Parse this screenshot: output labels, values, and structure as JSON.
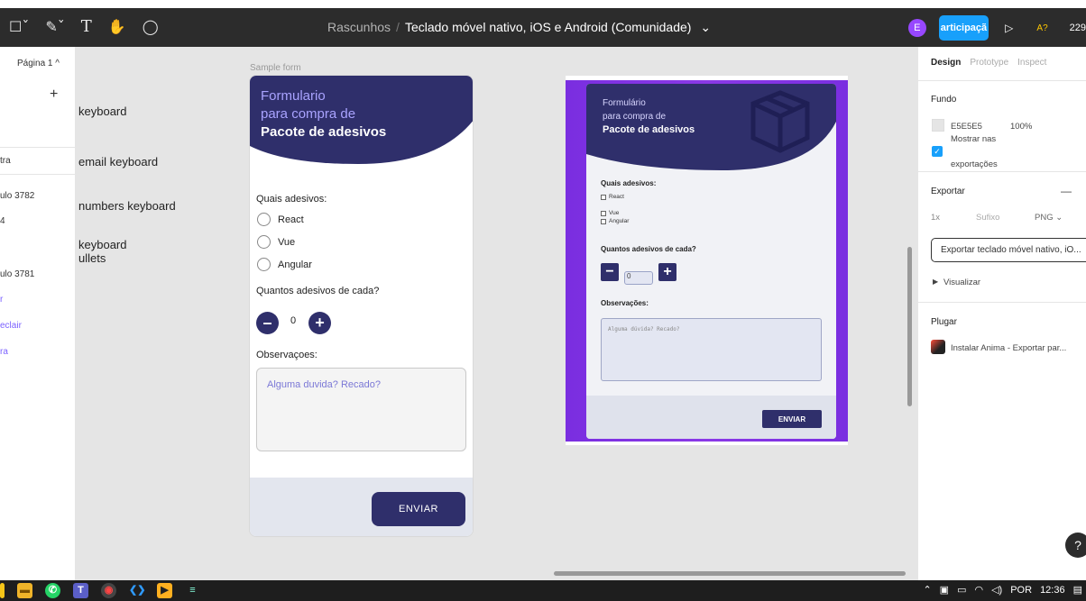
{
  "toolbar": {
    "breadcrumb_parent": "Rascunhos",
    "breadcrumb_sep": "/",
    "file_title": "Teclado móvel nativo, iOS e Android (Comunidade)",
    "title_chevron": "⌄",
    "avatar_letter": "E",
    "share_label": "articipaçã",
    "play_icon": "▷",
    "aa_label": "A?",
    "zoom": "229"
  },
  "left_panel": {
    "page_selector": "Página 1 ^",
    "add": "+",
    "items": [
      {
        "label": "tra"
      },
      {
        "label": "ulo 3782"
      },
      {
        "label": "4"
      },
      {
        "label": "ulo 3781"
      },
      {
        "label": "r"
      },
      {
        "label": "eclair"
      },
      {
        "label": "ra"
      }
    ]
  },
  "canvas": {
    "labels": [
      "keyboard",
      "email keyboard",
      "numbers keyboard",
      "keyboard",
      "ullets"
    ],
    "frame_label": "Sample form"
  },
  "form1": {
    "title_l1": "Formulario",
    "title_l2": "para compra de",
    "title_l3": "Pacote de adesivos",
    "q1": "Quais adesivos:",
    "options": [
      "React",
      "Vue",
      "Angular"
    ],
    "q2": "Quantos adesivos de cada?",
    "minus": "–",
    "plus": "+",
    "qty": "0",
    "q3": "Observaçoes:",
    "placeholder": "Alguma duvida? Recado?",
    "send": "ENVIAR"
  },
  "preview": {
    "title_l1": "Formulário",
    "title_l2": "para compra de",
    "title_l3": "Pacote de adesivos",
    "q1": "Quais adesivos:",
    "options": [
      "React",
      "Vue",
      "Angular"
    ],
    "q2": "Quantos adesivos de cada?",
    "minus": "−",
    "plus": "+",
    "qty": "0",
    "q3": "Observações:",
    "placeholder": "Alguma dúvida? Recado?",
    "send": "ENVIAR"
  },
  "right_panel": {
    "tabs": [
      "Design",
      "Prototype",
      "Inspect"
    ],
    "fundo": "Fundo",
    "color_hex": "E5E5E5",
    "opacity": "100%",
    "show_exports_l1": "Mostrar nas",
    "show_exports_l2": "exportações",
    "exportar": "Exportar",
    "exportar_minus": "—",
    "scale": "1x",
    "suffix": "Sufixo",
    "format": "PNG ⌄",
    "export_button": "Exportar teclado móvel nativo, iO...",
    "visualizar": "Visualizar",
    "plugar": "Plugar",
    "plugin": "Instalar Anima - Exportar par...",
    "help": "?"
  },
  "taskbar": {
    "lang": "POR",
    "time": "12:36"
  },
  "colors": {
    "toolbar_bg": "#2c2c2c",
    "canvas_bg": "#e5e5e5",
    "form_navy": "#2f2f6b",
    "preview_purple": "#8a39e6",
    "accent_blue": "#18a0fb"
  }
}
